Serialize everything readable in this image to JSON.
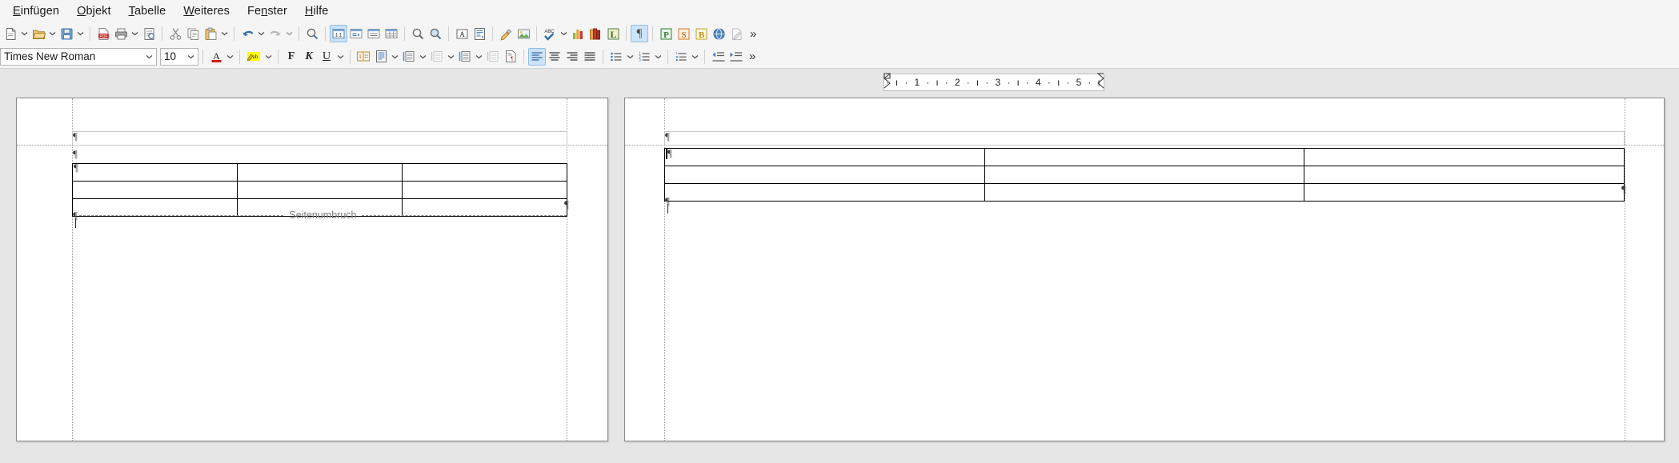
{
  "app": {
    "name": "LibreOffice Writer",
    "locale": "de"
  },
  "menubar": {
    "items": [
      {
        "label": "Einfügen",
        "accel": "E",
        "name": "menu-einfuegen"
      },
      {
        "label": "Objekt",
        "accel": "O",
        "name": "menu-objekt"
      },
      {
        "label": "Tabelle",
        "accel": "T",
        "name": "menu-tabelle"
      },
      {
        "label": "Weiteres",
        "accel": "W",
        "name": "menu-weiteres"
      },
      {
        "label": "Fenster",
        "accel": "n",
        "name": "menu-fenster"
      },
      {
        "label": "Hilfe",
        "accel": "H",
        "name": "menu-hilfe"
      }
    ]
  },
  "standard_toolbar": {
    "overflow_label": "»",
    "items": [
      {
        "icon": "new-document-icon",
        "label": "Neu",
        "state": "normal"
      },
      {
        "icon": "open-file-icon",
        "label": "Öffnen",
        "state": "normal"
      },
      {
        "icon": "save-icon",
        "label": "Speichern",
        "state": "normal"
      },
      {
        "icon": "separator",
        "label": ""
      },
      {
        "icon": "export-pdf-icon",
        "label": "Direkt als PDF exportieren",
        "state": "normal"
      },
      {
        "icon": "print-icon",
        "label": "Drucken",
        "state": "normal"
      },
      {
        "icon": "print-preview-icon",
        "label": "Druckvorschau",
        "state": "normal"
      },
      {
        "icon": "separator",
        "label": ""
      },
      {
        "icon": "cut-icon",
        "label": "Ausschneiden",
        "state": "normal"
      },
      {
        "icon": "copy-icon",
        "label": "Kopieren",
        "state": "normal"
      },
      {
        "icon": "paste-icon",
        "label": "Einfügen",
        "state": "normal"
      },
      {
        "icon": "separator",
        "label": ""
      },
      {
        "icon": "undo-icon",
        "label": "Rückgängig",
        "state": "normal"
      },
      {
        "icon": "redo-icon",
        "label": "Wiederherstellen",
        "state": "disabled"
      },
      {
        "icon": "separator",
        "label": ""
      },
      {
        "icon": "find-replace-icon",
        "label": "Suchen und Ersetzen",
        "state": "normal"
      },
      {
        "icon": "separator",
        "label": ""
      },
      {
        "icon": "zoom-100-icon",
        "label": "1:1",
        "state": "active"
      },
      {
        "icon": "formatting-marks-icon",
        "label": "Formatierungszeichen",
        "state": "normal"
      },
      {
        "icon": "insert-table-icon",
        "label": "Tabelle einfügen",
        "state": "normal"
      },
      {
        "icon": "insert-grid-icon",
        "label": "Raster",
        "state": "normal"
      },
      {
        "icon": "separator",
        "label": ""
      },
      {
        "icon": "zoom-in-icon",
        "label": "Vergrößern",
        "state": "normal"
      },
      {
        "icon": "zoom-out-icon",
        "label": "Verkleinern",
        "state": "normal"
      },
      {
        "icon": "separator",
        "label": ""
      },
      {
        "icon": "text-box-icon",
        "label": "Textrahmen einfügen",
        "state": "normal"
      },
      {
        "icon": "page-layout-icon",
        "label": "Seitenformat",
        "state": "normal"
      },
      {
        "icon": "clone-formatting-icon",
        "label": "Formatierung übertragen",
        "state": "normal"
      },
      {
        "icon": "insert-image-icon",
        "label": "Bild einfügen",
        "state": "normal"
      },
      {
        "icon": "separator",
        "label": ""
      },
      {
        "icon": "spelling-icon",
        "label": "Rechtschreibprüfung",
        "state": "normal"
      },
      {
        "icon": "insert-chart-icon",
        "label": "Diagramm einfügen",
        "state": "normal"
      },
      {
        "icon": "bibliography-icon",
        "label": "Literaturverzeichnis",
        "state": "normal"
      },
      {
        "icon": "line-numbering-icon",
        "label": "L",
        "state": "normal"
      },
      {
        "icon": "separator",
        "label": ""
      },
      {
        "icon": "pilcrow-icon",
        "label": "¶",
        "state": "active"
      },
      {
        "icon": "separator",
        "label": ""
      },
      {
        "icon": "presentation-icon",
        "label": "P",
        "state": "normal"
      },
      {
        "icon": "spreadsheet-icon",
        "label": "S",
        "state": "normal"
      },
      {
        "icon": "database-icon",
        "label": "B",
        "state": "normal"
      },
      {
        "icon": "web-icon",
        "label": "Web",
        "state": "normal"
      },
      {
        "icon": "track-changes-icon",
        "label": "Änderungen",
        "state": "disabled"
      }
    ]
  },
  "formatting_toolbar": {
    "overflow_label": "»",
    "font_name": {
      "value": "Times New Roman",
      "name": "font-name-combo"
    },
    "font_size": {
      "value": "10",
      "name": "font-size-combo"
    },
    "items": [
      {
        "icon": "font-color-icon",
        "label": "A",
        "state": "normal",
        "color": "#d41616"
      },
      {
        "icon": "highlight-color-icon",
        "label": "ab",
        "state": "normal",
        "color": "#ffff00"
      },
      {
        "icon": "bold-icon",
        "label": "F",
        "state": "normal"
      },
      {
        "icon": "italic-icon",
        "label": "K",
        "state": "normal"
      },
      {
        "icon": "underline-icon",
        "label": "U",
        "state": "normal"
      },
      {
        "icon": "page-number-icon",
        "label": "Seitennummer",
        "state": "normal"
      },
      {
        "icon": "page-style-icon",
        "label": "Seitenvorlage",
        "state": "normal"
      },
      {
        "icon": "increase-spacing-icon",
        "label": "Abstand erhöhen",
        "state": "normal"
      },
      {
        "icon": "decrease-spacing-icon",
        "label": "Abstand verringern",
        "state": "disabled"
      },
      {
        "icon": "increase-spacing2-icon",
        "label": "Absatzabstand",
        "state": "normal"
      },
      {
        "icon": "decrease-spacing2-icon",
        "label": "Absatzabstand",
        "state": "disabled"
      },
      {
        "icon": "paragraph-style-icon",
        "label": "Absatzvorlage",
        "state": "normal"
      },
      {
        "icon": "align-left-icon",
        "label": "Linksbündig",
        "state": "active"
      },
      {
        "icon": "align-center-icon",
        "label": "Zentriert",
        "state": "normal"
      },
      {
        "icon": "align-right-icon",
        "label": "Rechtsbündig",
        "state": "normal"
      },
      {
        "icon": "align-justify-icon",
        "label": "Blocksatz",
        "state": "normal"
      },
      {
        "icon": "bullet-list-icon",
        "label": "Ungeordnete Liste",
        "state": "normal"
      },
      {
        "icon": "numbered-list-icon",
        "label": "Geordnete Liste",
        "state": "normal"
      },
      {
        "icon": "outline-list-icon",
        "label": "Gliederungsliste",
        "state": "normal"
      },
      {
        "icon": "decrease-indent-icon",
        "label": "Einzug verkleinern",
        "state": "normal"
      },
      {
        "icon": "increase-indent-icon",
        "label": "Einzug vergrößern",
        "state": "normal"
      }
    ]
  },
  "ruler": {
    "name": "horizontal-ruler",
    "ticks": "· ı · 1 · ı · 2 · ı · 3 · ı · 4 · ı · 5 · ı",
    "unit": "cm",
    "marks": [
      "1",
      "2",
      "3",
      "4",
      "5"
    ]
  },
  "document": {
    "view_mode": "multi-page",
    "pages": [
      {
        "id": "page-left",
        "has_header_frame": true,
        "table": {
          "rows": 3,
          "cols": 3,
          "cells": [
            [
              "",
              "",
              ""
            ],
            [
              "",
              "",
              ""
            ],
            [
              "",
              "",
              ""
            ]
          ]
        },
        "page_break": {
          "label": "Seitenumbruch",
          "visible": true
        },
        "paragraph_marks": 4,
        "cursor_visible": false
      },
      {
        "id": "page-right",
        "has_header_frame": true,
        "table": {
          "rows": 3,
          "cols": 3,
          "cells": [
            [
              "",
              "",
              ""
            ],
            [
              "",
              "",
              ""
            ],
            [
              "",
              "",
              ""
            ]
          ]
        },
        "page_break": {
          "label": "",
          "visible": false
        },
        "paragraph_marks": 3,
        "cursor_visible": true
      }
    ],
    "formatting_mark_glyph": "¶"
  },
  "colors": {
    "canvas_background": "#e6e6e6",
    "toolbar_background": "#f5f5f5",
    "page_background": "#ffffff",
    "page_border": "#8a8a8a",
    "active_highlight": "#cde3f7",
    "active_border": "#8fbde8",
    "table_border": "#000000",
    "boundary_guide": "#9c9c9c",
    "pagebreak_text": "#7d7d7d"
  }
}
